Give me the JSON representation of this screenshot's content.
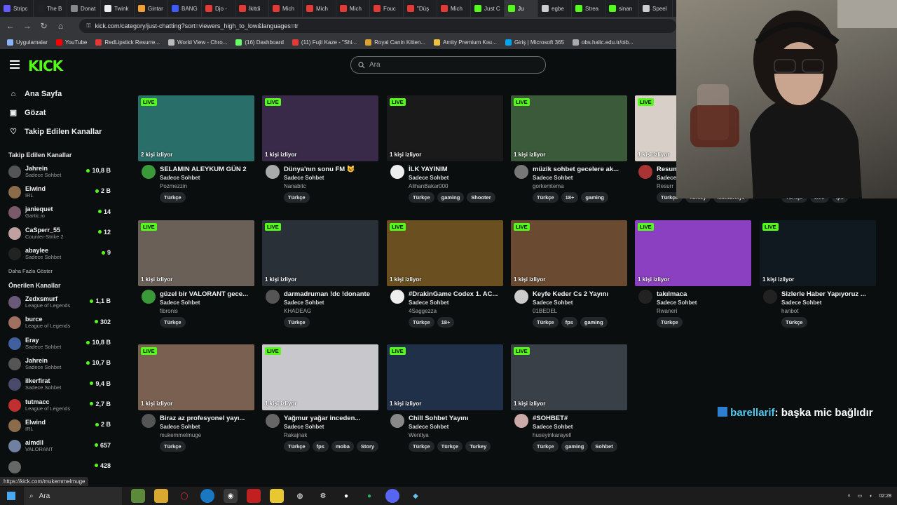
{
  "browser": {
    "tabs": [
      {
        "label": "Stripc",
        "color": "#635bff"
      },
      {
        "label": "The B",
        "color": "#222"
      },
      {
        "label": "Donat",
        "color": "#888"
      },
      {
        "label": "Twink",
        "color": "#eee"
      },
      {
        "label": "Gintar",
        "color": "#f0a030"
      },
      {
        "label": "BANG",
        "color": "#3d5afe"
      },
      {
        "label": "Djo -",
        "color": "#e53935"
      },
      {
        "label": "İkitdi",
        "color": "#e53935"
      },
      {
        "label": "Mich",
        "color": "#e53935"
      },
      {
        "label": "Mich",
        "color": "#e53935"
      },
      {
        "label": "Mich",
        "color": "#e53935"
      },
      {
        "label": "Fouc",
        "color": "#e53935"
      },
      {
        "label": "\"Düş",
        "color": "#e53935"
      },
      {
        "label": "Mich",
        "color": "#e53935"
      },
      {
        "label": "Just C",
        "color": "#53fc18"
      },
      {
        "label": "Ju",
        "color": "#53fc18",
        "active": true
      },
      {
        "label": "egbe",
        "color": "#ccc"
      },
      {
        "label": "Strea",
        "color": "#53fc18"
      },
      {
        "label": "sinan",
        "color": "#53fc18"
      },
      {
        "label": "Speel",
        "color": "#ccc"
      }
    ],
    "url": "kick.com/category/just-chatting?sort=viewers_high_to_low&languages=tr",
    "bookmarks": [
      {
        "label": "Uygulamalar",
        "color": "#8ab4f8"
      },
      {
        "label": "YouTube",
        "color": "#ff0000"
      },
      {
        "label": "RedLipstick Resurre...",
        "color": "#e53935"
      },
      {
        "label": "World View - Chro...",
        "color": "#bbb"
      },
      {
        "label": "(16) Dashboard",
        "color": "#6f6"
      },
      {
        "label": "(11) Fujii Kaze - \"Shi...",
        "color": "#e53935"
      },
      {
        "label": "Royal Canin Kitten...",
        "color": "#e0a030"
      },
      {
        "label": "Amity Premium Kısı...",
        "color": "#f0c040"
      },
      {
        "label": "Giriş | Microsoft 365",
        "color": "#00a4ef"
      },
      {
        "label": "obs.halic.edu.tr/oib...",
        "color": "#aaa"
      }
    ]
  },
  "header": {
    "logo": "KICK",
    "search_placeholder": "Ara"
  },
  "nav": [
    {
      "label": "Ana Sayfa",
      "icon": "⌂"
    },
    {
      "label": "Gözat",
      "icon": "▣"
    },
    {
      "label": "Takip Edilen Kanallar",
      "icon": "♡"
    }
  ],
  "followed": {
    "title": "Takip Edilen Kanallar",
    "items": [
      {
        "name": "Jahrein",
        "cat": "Sadece Sohbet",
        "views": "10,8 B",
        "color": "#555"
      },
      {
        "name": "Elwind",
        "cat": "IRL",
        "views": "2 B",
        "color": "#8b6b4a"
      },
      {
        "name": "janiequet",
        "cat": "Gartic.io",
        "views": "14",
        "color": "#7a5a6a"
      },
      {
        "name": "CaSperr_55",
        "cat": "Counter-Strike 2",
        "views": "12",
        "color": "#c0a0a0"
      },
      {
        "name": "abaylee",
        "cat": "Sadece Sohbet",
        "views": "9",
        "color": "#222"
      }
    ],
    "more": "Daha Fazla Göster"
  },
  "recommended": {
    "title": "Önerilen Kanallar",
    "items": [
      {
        "name": "Zedxsmurf",
        "cat": "League of Legends",
        "views": "1,1 B",
        "color": "#6a5a7a"
      },
      {
        "name": "burce",
        "cat": "League of Legends",
        "views": "302",
        "color": "#a07060"
      },
      {
        "name": "Eray",
        "cat": "Sadece Sohbet",
        "views": "10,8 B",
        "color": "#4060a0"
      },
      {
        "name": "Jahrein",
        "cat": "Sadece Sohbet",
        "views": "10,7 B",
        "color": "#555"
      },
      {
        "name": "ilkerfirat",
        "cat": "Sadece Sohbet",
        "views": "9,4 B",
        "color": "#4a4a6a"
      },
      {
        "name": "tutmacc",
        "cat": "League of Legends",
        "views": "2,7 B",
        "color": "#c03030"
      },
      {
        "name": "Elwind",
        "cat": "IRL",
        "views": "2 B",
        "color": "#8b6b4a"
      },
      {
        "name": "aimdll",
        "cat": "VALORANT",
        "views": "657",
        "color": "#7080a0"
      },
      {
        "name": "",
        "cat": "",
        "views": "428",
        "color": "#666"
      }
    ]
  },
  "cards": [
    {
      "title": "SELAMIN ALEYKUM GÜN 2",
      "cat": "Sadece Sohbet",
      "user": "Pozmezzin",
      "tags": [
        "Türkçe"
      ],
      "views": "2 kişi izliyor",
      "live": "LIVE",
      "thumb": "#2a6e6a",
      "avatar": "#3a9a3a"
    },
    {
      "title": "Dünya'nın sonu FM 😺",
      "cat": "Sadece Sohbet",
      "user": "Nanabitc",
      "tags": [
        "Türkçe"
      ],
      "views": "1 kişi izliyor",
      "live": "LIVE",
      "thumb": "#3a2a4a",
      "avatar": "#aaa"
    },
    {
      "title": "İLK YAYINIM",
      "cat": "Sadece Sohbet",
      "user": "AlihanBakar000",
      "tags": [
        "Türkçe",
        "gaming",
        "Shooter"
      ],
      "views": "1 kişi izliyor",
      "live": "LIVE",
      "thumb": "#1a1a1a",
      "avatar": "#eee"
    },
    {
      "title": "müzik sohbet gecelere ak...",
      "cat": "Sadece Sohbet",
      "user": "gorkemtema",
      "tags": [
        "Türkçe",
        "18+",
        "gaming"
      ],
      "views": "1 kişi izliyor",
      "live": "LIVE",
      "thumb": "#3a5a3a",
      "avatar": "#777"
    },
    {
      "title": "Resum",
      "cat": "Sadece",
      "user": "Resurr",
      "tags": [
        "Türkçe",
        "Turkey",
        "kickturkiye"
      ],
      "views": "1 kişi izliyor",
      "live": "LIVE",
      "thumb": "#d8d0c8",
      "avatar": "#a33"
    },
    {
      "title": "",
      "cat": "",
      "user": "",
      "tags": [
        "Türkçe",
        "chill",
        "fps"
      ],
      "views": "",
      "live": "",
      "thumb": "transparent",
      "avatar": "transparent"
    },
    {
      "title": "güzel bir VALORANT gece...",
      "cat": "Sadece Sohbet",
      "user": "fibronis",
      "tags": [
        "Türkçe"
      ],
      "views": "1 kişi izliyor",
      "live": "LIVE",
      "thumb": "#6a6058",
      "avatar": "#3a9a3a"
    },
    {
      "title": "darmadruman !dc !donante",
      "cat": "Sadece Sohbet",
      "user": "KHADEAG",
      "tags": [
        "Türkçe"
      ],
      "views": "1 kişi izliyor",
      "live": "LIVE",
      "thumb": "#2a3038",
      "avatar": "#555"
    },
    {
      "title": "#DrakinGame Codex 1. AC...",
      "cat": "Sadece Sohbet",
      "user": "4Saggezza",
      "tags": [
        "Türkçe",
        "18+"
      ],
      "views": "1 kişi izliyor",
      "live": "LIVE",
      "thumb": "#6a5020",
      "avatar": "#eee"
    },
    {
      "title": "Keyfe Keder Cs 2 Yayını",
      "cat": "Sadece Sohbet",
      "user": "01BEDEL",
      "tags": [
        "Türkçe",
        "fps",
        "gaming"
      ],
      "views": "1 kişi izliyor",
      "live": "LIVE",
      "thumb": "#6a4a30",
      "avatar": "#ccc"
    },
    {
      "title": "takılmaca",
      "cat": "Sadece Sohbet",
      "user": "Rwaneri",
      "tags": [
        "Türkçe"
      ],
      "views": "1 kişi izliyor",
      "live": "LIVE",
      "thumb": "#8a40c0",
      "avatar": "#222"
    },
    {
      "title": "Sizlerle Haber Yapıyoruz ...",
      "cat": "Sadece Sohbet",
      "user": "hanbot",
      "tags": [
        "Türkçe"
      ],
      "views": "1 kişi izliyor",
      "live": "LIVE",
      "thumb": "#101820",
      "avatar": "#222"
    },
    {
      "title": "Biraz az profesyonel yayı...",
      "cat": "Sadece Sohbet",
      "user": "mukemmelmuge",
      "tags": [
        "Türkçe"
      ],
      "views": "1 kişi izliyor",
      "live": "LIVE",
      "thumb": "#7a6050",
      "avatar": "#555"
    },
    {
      "title": "Yağmur yağar inceden...",
      "cat": "Sadece Sohbet",
      "user": "Rakajnak",
      "tags": [
        "Türkçe",
        "fps",
        "moba",
        "Story"
      ],
      "views": "1 kişi izliyor",
      "live": "LIVE",
      "thumb": "#c8c8cc",
      "avatar": "#666"
    },
    {
      "title": "Chill Sohbet Yayını",
      "cat": "Sadece Sohbet",
      "user": "Wentiya",
      "tags": [
        "Türkçe",
        "Türkçe",
        "Turkey"
      ],
      "views": "1 kişi izliyor",
      "live": "LIVE",
      "thumb": "#203048",
      "avatar": "#888"
    },
    {
      "title": "#SOHBET#",
      "cat": "Sadece Sohbet",
      "user": "huseyinkarayell",
      "tags": [
        "Türkçe",
        "gaming",
        "Sohbet"
      ],
      "views": "1 kişi izliyor",
      "live": "LIVE",
      "thumb": "#3a4048",
      "avatar": "#caa"
    }
  ],
  "chat": {
    "user": "barellarif",
    "message": ": başka mic bağlıdır"
  },
  "status_url": "https://kick.com/mukemmelmuge",
  "taskbar": {
    "search": "Ara",
    "time": "02:28"
  },
  "colors": {
    "accent": "#53fc18",
    "background": "#0b0e0f"
  }
}
